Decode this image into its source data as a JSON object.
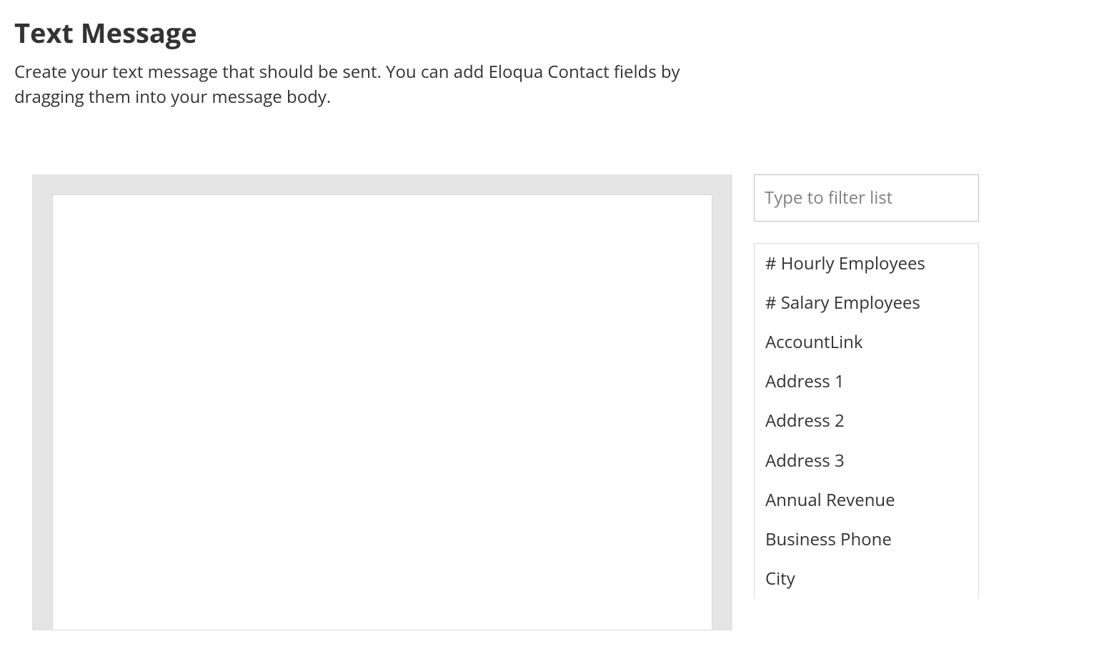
{
  "header": {
    "title": "Text Message",
    "description": "Create your text message that should be sent. You can add Eloqua Contact fields by dragging them into your message body."
  },
  "editor": {
    "value": ""
  },
  "sidebar": {
    "filter_placeholder": "Type to filter list",
    "filter_value": "",
    "fields": [
      "# Hourly Employees",
      "# Salary Employees",
      "AccountLink",
      "Address 1",
      "Address 2",
      "Address 3",
      "Annual Revenue",
      "Business Phone",
      "City"
    ]
  }
}
